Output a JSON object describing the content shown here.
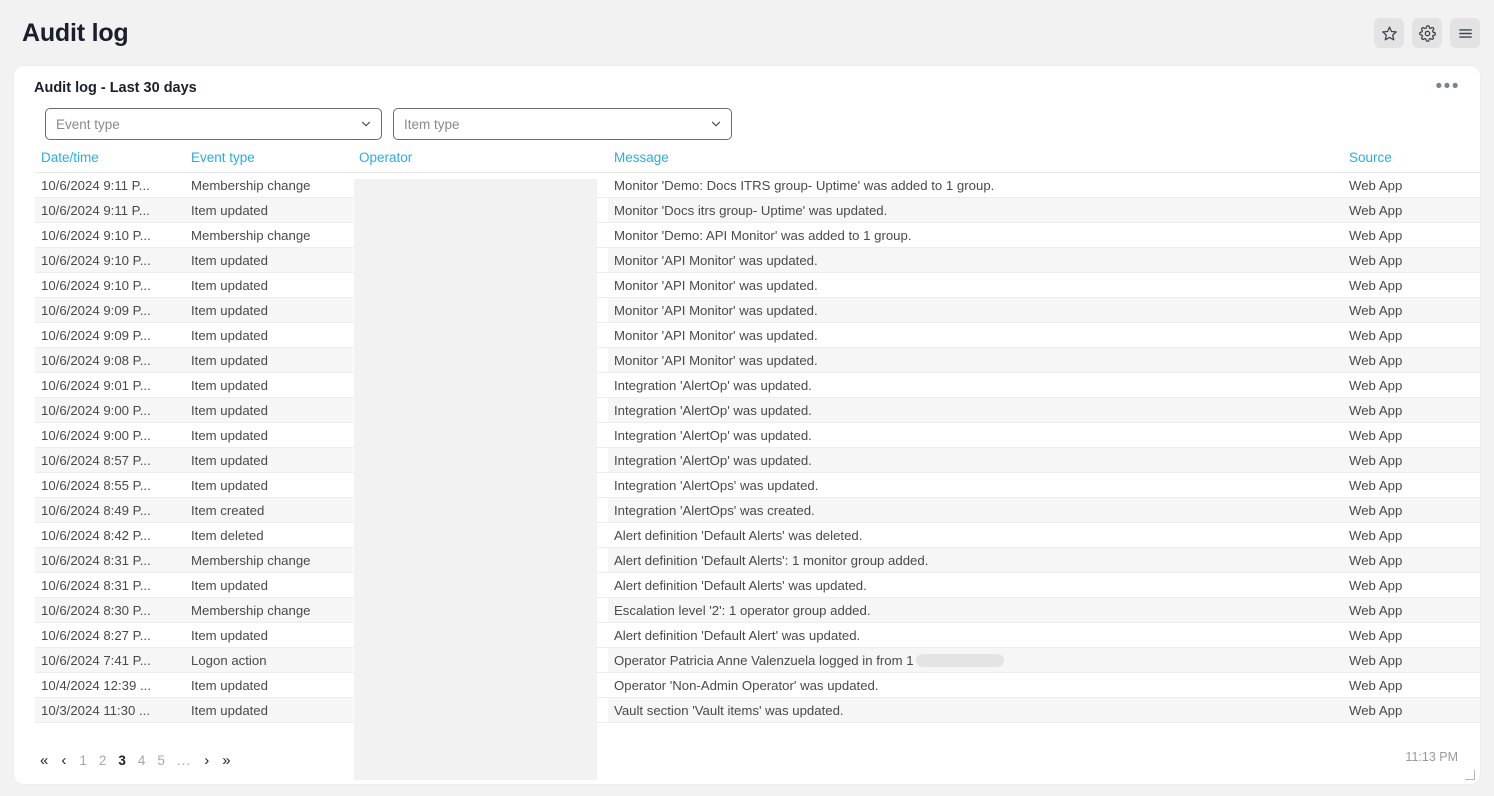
{
  "header": {
    "title": "Audit log",
    "actions": [
      {
        "name": "favorite-button",
        "icon": "star-icon"
      },
      {
        "name": "settings-button",
        "icon": "gear-icon"
      },
      {
        "name": "menu-button",
        "icon": "hamburger-icon"
      }
    ]
  },
  "card": {
    "title": "Audit log - Last 30 days",
    "menu_label": "•••",
    "timestamp": "11:13 PM"
  },
  "filters": {
    "event_type": {
      "label": "Event type",
      "value": "",
      "placeholder": "Event type"
    },
    "item_type": {
      "label": "Item type",
      "value": "",
      "placeholder": "Item type"
    }
  },
  "table": {
    "columns": [
      "Date/time",
      "Event type",
      "Operator",
      "Message",
      "Source"
    ],
    "rows": [
      {
        "datetime": "10/6/2024 9:11 P...",
        "event": "Membership change",
        "operator": "",
        "message": "Monitor 'Demo: Docs ITRS group- Uptime' was added to 1 group.",
        "source": "Web App"
      },
      {
        "datetime": "10/6/2024 9:11 P...",
        "event": "Item updated",
        "operator": "",
        "message": "Monitor 'Docs itrs group- Uptime' was updated.",
        "source": "Web App"
      },
      {
        "datetime": "10/6/2024 9:10 P...",
        "event": "Membership change",
        "operator": "",
        "message": "Monitor 'Demo: API Monitor' was added to 1 group.",
        "source": "Web App"
      },
      {
        "datetime": "10/6/2024 9:10 P...",
        "event": "Item updated",
        "operator": "",
        "message": "Monitor 'API Monitor' was updated.",
        "source": "Web App"
      },
      {
        "datetime": "10/6/2024 9:10 P...",
        "event": "Item updated",
        "operator": "",
        "message": "Monitor 'API Monitor' was updated.",
        "source": "Web App"
      },
      {
        "datetime": "10/6/2024 9:09 P...",
        "event": "Item updated",
        "operator": "",
        "message": "Monitor 'API Monitor' was updated.",
        "source": "Web App"
      },
      {
        "datetime": "10/6/2024 9:09 P...",
        "event": "Item updated",
        "operator": "",
        "message": "Monitor 'API Monitor' was updated.",
        "source": "Web App"
      },
      {
        "datetime": "10/6/2024 9:08 P...",
        "event": "Item updated",
        "operator": "",
        "message": "Monitor 'API Monitor' was updated.",
        "source": "Web App"
      },
      {
        "datetime": "10/6/2024 9:01 P...",
        "event": "Item updated",
        "operator": "",
        "message": "Integration 'AlertOp' was updated.",
        "source": "Web App"
      },
      {
        "datetime": "10/6/2024 9:00 P...",
        "event": "Item updated",
        "operator": "",
        "message": "Integration 'AlertOp' was updated.",
        "source": "Web App"
      },
      {
        "datetime": "10/6/2024 9:00 P...",
        "event": "Item updated",
        "operator": "",
        "message": "Integration 'AlertOp' was updated.",
        "source": "Web App"
      },
      {
        "datetime": "10/6/2024 8:57 P...",
        "event": "Item updated",
        "operator": "",
        "message": "Integration 'AlertOp' was updated.",
        "source": "Web App"
      },
      {
        "datetime": "10/6/2024 8:55 P...",
        "event": "Item updated",
        "operator": "",
        "message": "Integration 'AlertOps' was updated.",
        "source": "Web App"
      },
      {
        "datetime": "10/6/2024 8:49 P...",
        "event": "Item created",
        "operator": "",
        "message": "Integration 'AlertOps' was created.",
        "source": "Web App"
      },
      {
        "datetime": "10/6/2024 8:42 P...",
        "event": "Item deleted",
        "operator": "",
        "message": "Alert definition 'Default Alerts' was deleted.",
        "source": "Web App"
      },
      {
        "datetime": "10/6/2024 8:31 P...",
        "event": "Membership change",
        "operator": "",
        "message": "Alert definition 'Default Alerts': 1 monitor group added.",
        "source": "Web App"
      },
      {
        "datetime": "10/6/2024 8:31 P...",
        "event": "Item updated",
        "operator": "",
        "message": "Alert definition 'Default Alerts' was updated.",
        "source": "Web App"
      },
      {
        "datetime": "10/6/2024 8:30 P...",
        "event": "Membership change",
        "operator": "",
        "message": "Escalation level '2': 1 operator group added.",
        "source": "Web App"
      },
      {
        "datetime": "10/6/2024 8:27 P...",
        "event": "Item updated",
        "operator": "",
        "message": "Alert definition 'Default Alert' was updated.",
        "source": "Web App"
      },
      {
        "datetime": "10/6/2024 7:41 P...",
        "event": "Logon action",
        "operator": "",
        "message": "Operator Patricia Anne Valenzuela logged in from 1",
        "message_redacted": true,
        "source": "Web App"
      },
      {
        "datetime": "10/4/2024 12:39 ...",
        "event": "Item updated",
        "operator": "",
        "message": "Operator 'Non-Admin Operator' was updated.",
        "source": "Web App"
      },
      {
        "datetime": "10/3/2024 11:30 ...",
        "event": "Item updated",
        "operator": "",
        "message": "Vault section 'Vault items' was updated.",
        "source": "Web App"
      }
    ]
  },
  "pagination": {
    "first_label": "«",
    "prev_label": "‹",
    "pages": [
      "1",
      "2",
      "3",
      "4",
      "5"
    ],
    "active_page": "3",
    "ellipsis": "...",
    "next_label": "›",
    "last_label": "»"
  },
  "colors": {
    "header_link": "#2badde",
    "page_bg": "#f2f2f2",
    "card_bg": "#ffffff",
    "row_alt_bg": "#f6f6f6",
    "text": "#4a4a4a"
  }
}
